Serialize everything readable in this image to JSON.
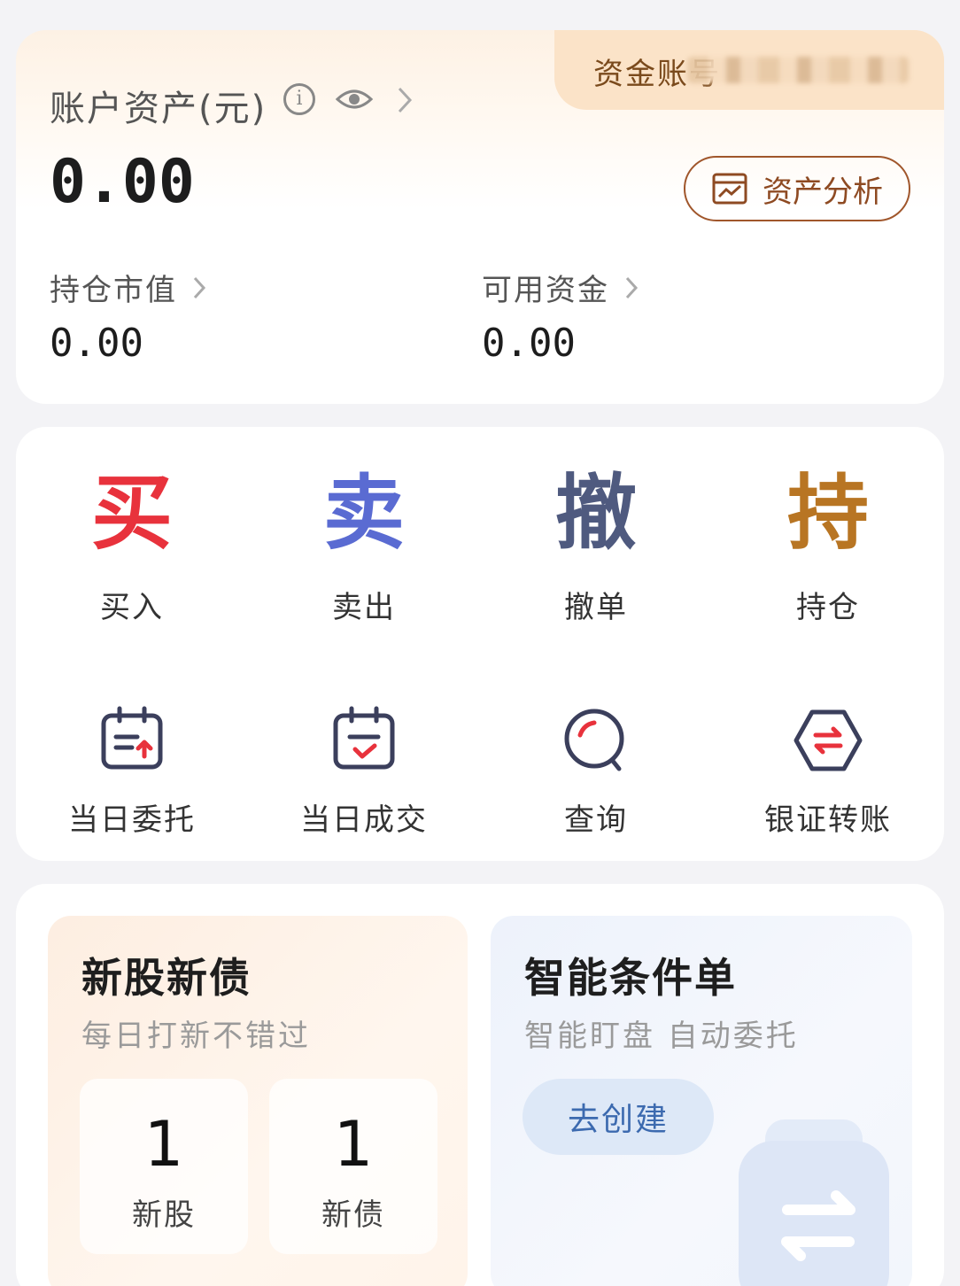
{
  "account": {
    "tab_label": "资金账号",
    "title": "账户资产(元)",
    "total_value": "0.00",
    "analysis_label": "资产分析",
    "market_value_label": "持仓市值",
    "market_value": "0.00",
    "available_funds_label": "可用资金",
    "available_funds": "0.00"
  },
  "trade_actions": [
    {
      "char": "买",
      "label": "买入",
      "color": "#e8323c"
    },
    {
      "char": "卖",
      "label": "卖出",
      "color": "#5a6bd2"
    },
    {
      "char": "撤",
      "label": "撤单",
      "color": "#4f5a7f"
    },
    {
      "char": "持",
      "label": "持仓",
      "color": "#b87523"
    }
  ],
  "tools": [
    {
      "label": "当日委托",
      "icon": "calendar-upload-icon"
    },
    {
      "label": "当日成交",
      "icon": "calendar-check-icon"
    },
    {
      "label": "查询",
      "icon": "search-icon"
    },
    {
      "label": "银证转账",
      "icon": "transfer-hexagon-icon"
    }
  ],
  "ipo": {
    "title": "新股新债",
    "subtitle": "每日打新不错过",
    "stocks_count": "1",
    "stocks_label": "新股",
    "bonds_count": "1",
    "bonds_label": "新债"
  },
  "conditional": {
    "title": "智能条件单",
    "subtitle": "智能盯盘 自动委托",
    "create_label": "去创建"
  },
  "colors": {
    "accent_brown": "#a0562b",
    "icon_navy": "#3b3f5c",
    "icon_red": "#e8323c"
  }
}
